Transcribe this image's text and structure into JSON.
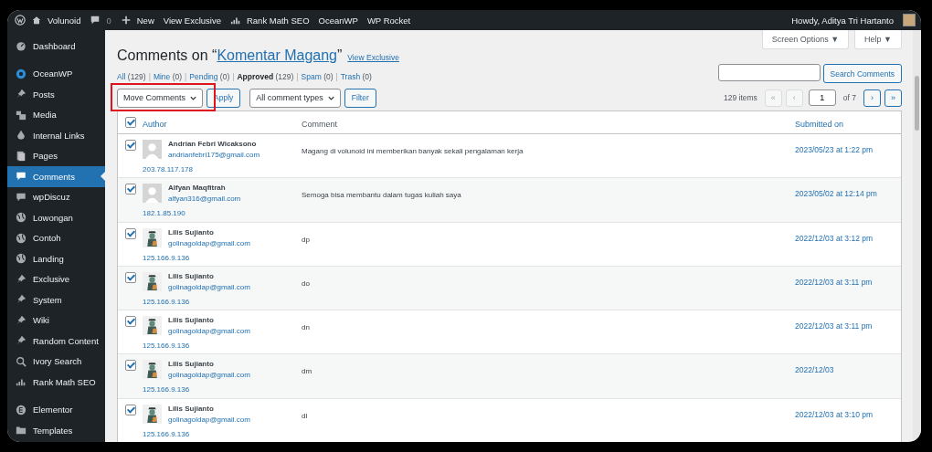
{
  "admin_bar": {
    "site": "Volunoid",
    "comment_count": "0",
    "items": [
      "New",
      "View Exclusive",
      "Rank Math SEO",
      "OceanWP",
      "WP Rocket"
    ],
    "greeting": "Howdy, Aditya Tri Hartanto"
  },
  "sidebar": {
    "groups": [
      {
        "items": [
          {
            "label": "Dashboard",
            "selected": false
          }
        ]
      },
      {
        "items": [
          {
            "label": "OceanWP",
            "selected": false
          },
          {
            "label": "Posts",
            "selected": false
          },
          {
            "label": "Media",
            "selected": false
          },
          {
            "label": "Internal Links",
            "selected": false
          },
          {
            "label": "Pages",
            "selected": false
          },
          {
            "label": "Comments",
            "selected": true
          },
          {
            "label": "wpDiscuz",
            "selected": false
          },
          {
            "label": "Lowongan",
            "selected": false
          },
          {
            "label": "Contoh",
            "selected": false
          },
          {
            "label": "Landing",
            "selected": false
          },
          {
            "label": "Exclusive",
            "selected": false
          },
          {
            "label": "System",
            "selected": false
          },
          {
            "label": "Wiki",
            "selected": false
          },
          {
            "label": "Random Content",
            "selected": false
          },
          {
            "label": "Ivory Search",
            "selected": false
          },
          {
            "label": "Rank Math SEO",
            "selected": false
          }
        ]
      },
      {
        "items": [
          {
            "label": "Elementor",
            "selected": false
          },
          {
            "label": "Templates",
            "selected": false
          }
        ]
      }
    ]
  },
  "top_buttons": [
    "Screen Options ▼",
    "Help ▼"
  ],
  "title": {
    "prefix": "Comments on “",
    "post": "Komentar Magang",
    "suffix": "”",
    "link": "View Exclusive"
  },
  "status_separator": "|",
  "status_filters": [
    {
      "label": "All",
      "count": "(129)",
      "selected": false
    },
    {
      "label": "Mine",
      "count": "(0)",
      "selected": false
    },
    {
      "label": "Pending",
      "count": "(0)",
      "selected": false
    },
    {
      "label": "Approved",
      "count": "(129)",
      "selected": true
    },
    {
      "label": "Spam",
      "count": "(0)",
      "selected": false
    },
    {
      "label": "Trash",
      "count": "(0)",
      "selected": false
    }
  ],
  "search": {
    "button": "Search Comments"
  },
  "bulk_action": "Move Comments",
  "apply": "Apply",
  "type_filter": "All comment types",
  "filter": "Filter",
  "pagination": {
    "items": "129 items",
    "first": "«",
    "prev": "‹",
    "page": "1",
    "of": "of 7",
    "next": "›",
    "last": "»"
  },
  "table": {
    "columns": [
      "Author",
      "Comment",
      "Submitted on"
    ],
    "all_checked": true,
    "rows": [
      {
        "checked": true,
        "kind": "mystery",
        "name": "Andrian Febri Wicaksono",
        "email": "andrianfebri175@gmail.com",
        "ip": "203.78.117.178",
        "comment": "Magang di volunoid ini memberikan banyak sekali pengalaman kerja",
        "date": "2023/05/23 at 1:22 pm"
      },
      {
        "checked": true,
        "kind": "mystery",
        "name": "Alfyan Maqfitrah",
        "email": "alfyan316@gmail.com",
        "ip": "182.1.85.190",
        "comment": "Semoga bisa membantu dalam tugas kuliah saya",
        "date": "2023/05/02 at 12:14 pm"
      },
      {
        "checked": true,
        "kind": "figure",
        "name": "Lilis Sujianto",
        "email": "golinagoldap@gmail.com",
        "ip": "125.166.9.136",
        "comment": "dp",
        "date": "2022/12/03 at 3:12 pm"
      },
      {
        "checked": true,
        "kind": "figure",
        "name": "Lilis Sujianto",
        "email": "golinagoldap@gmail.com",
        "ip": "125.166.9.136",
        "comment": "do",
        "date": "2022/12/03 at 3:11 pm"
      },
      {
        "checked": true,
        "kind": "figure",
        "name": "Lilis Sujianto",
        "email": "golinagoldap@gmail.com",
        "ip": "125.166.9.136",
        "comment": "dn",
        "date": "2022/12/03 at 3:11 pm"
      },
      {
        "checked": true,
        "kind": "figure",
        "name": "Lilis Sujianto",
        "email": "golinagoldap@gmail.com",
        "ip": "125.166.9.136",
        "comment": "dm",
        "date": "2022/12/03"
      },
      {
        "checked": true,
        "kind": "figure",
        "name": "Lilis Sujianto",
        "email": "golinagoldap@gmail.com",
        "ip": "125.166.9.136",
        "comment": "dl",
        "date": "2022/12/03 at 3:10 pm"
      }
    ]
  }
}
